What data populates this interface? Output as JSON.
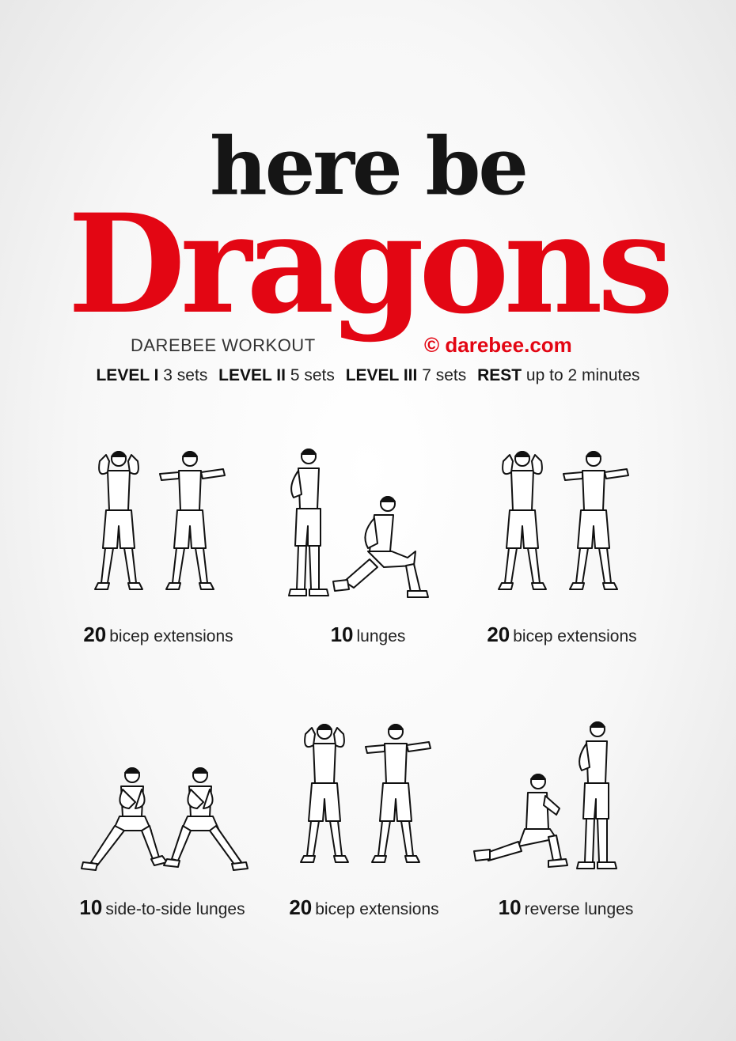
{
  "title": {
    "line1": "here be",
    "line2": "Dragons"
  },
  "subtitle": "DAREBEE WORKOUT",
  "copyright": "© darebee.com",
  "levels": [
    {
      "name": "LEVEL I",
      "value": "3 sets"
    },
    {
      "name": "LEVEL II",
      "value": "5 sets"
    },
    {
      "name": "LEVEL III",
      "value": "7 sets"
    },
    {
      "name": "REST",
      "value": "up to 2 minutes"
    }
  ],
  "exercises": [
    {
      "count": "20",
      "name": "bicep extensions",
      "illustration": "bicep-extensions-icon"
    },
    {
      "count": "10",
      "name": "lunges",
      "illustration": "lunges-icon"
    },
    {
      "count": "20",
      "name": "bicep extensions",
      "illustration": "bicep-extensions-icon"
    },
    {
      "count": "10",
      "name": "side-to-side lunges",
      "illustration": "side-lunges-icon"
    },
    {
      "count": "20",
      "name": "bicep extensions",
      "illustration": "bicep-extensions-icon"
    },
    {
      "count": "10",
      "name": "reverse lunges",
      "illustration": "reverse-lunges-icon"
    }
  ],
  "colors": {
    "accent": "#e30613",
    "text": "#111111"
  }
}
